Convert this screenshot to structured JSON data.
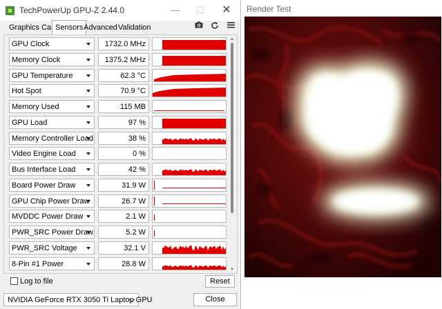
{
  "gpuz": {
    "title": "TechPowerUp GPU-Z 2.44.0",
    "tabs": [
      {
        "label": "Graphics Card"
      },
      {
        "label": "Sensors"
      },
      {
        "label": "Advanced"
      },
      {
        "label": "Validation"
      }
    ],
    "active_tab": "Sensors",
    "toolbar_icons": [
      "camera-icon",
      "refresh-icon",
      "menu-icon"
    ],
    "sensors": [
      {
        "label": "GPU Clock",
        "value": "1732.0 MHz"
      },
      {
        "label": "Memory Clock",
        "value": "1375.2 MHz"
      },
      {
        "label": "GPU Temperature",
        "value": "62.3 °C"
      },
      {
        "label": "Hot Spot",
        "value": "70.9 °C"
      },
      {
        "label": "Memory Used",
        "value": "115 MB"
      },
      {
        "label": "GPU Load",
        "value": "97 %"
      },
      {
        "label": "Memory Controller Load",
        "value": "38 %"
      },
      {
        "label": "Video Engine Load",
        "value": "0 %"
      },
      {
        "label": "Bus Interface Load",
        "value": "42 %"
      },
      {
        "label": "Board Power Draw",
        "value": "31.9 W"
      },
      {
        "label": "GPU Chip Power Draw",
        "value": "26.7 W"
      },
      {
        "label": "MVDDC Power Draw",
        "value": "2.1 W"
      },
      {
        "label": "PWR_SRC Power Draw",
        "value": "5.2 W"
      },
      {
        "label": "PWR_SRC Voltage",
        "value": "32.1 V"
      },
      {
        "label": "8-Pin #1 Power",
        "value": "28.8 W"
      }
    ],
    "log_to_file": {
      "label": "Log to file",
      "checked": false
    },
    "reset_label": "Reset",
    "gpu_select": "NVIDIA GeForce RTX 3050 Ti Laptop GPU",
    "close_label": "Close",
    "graph_color": "#e00000"
  },
  "render_test": {
    "title": "Render Test"
  }
}
